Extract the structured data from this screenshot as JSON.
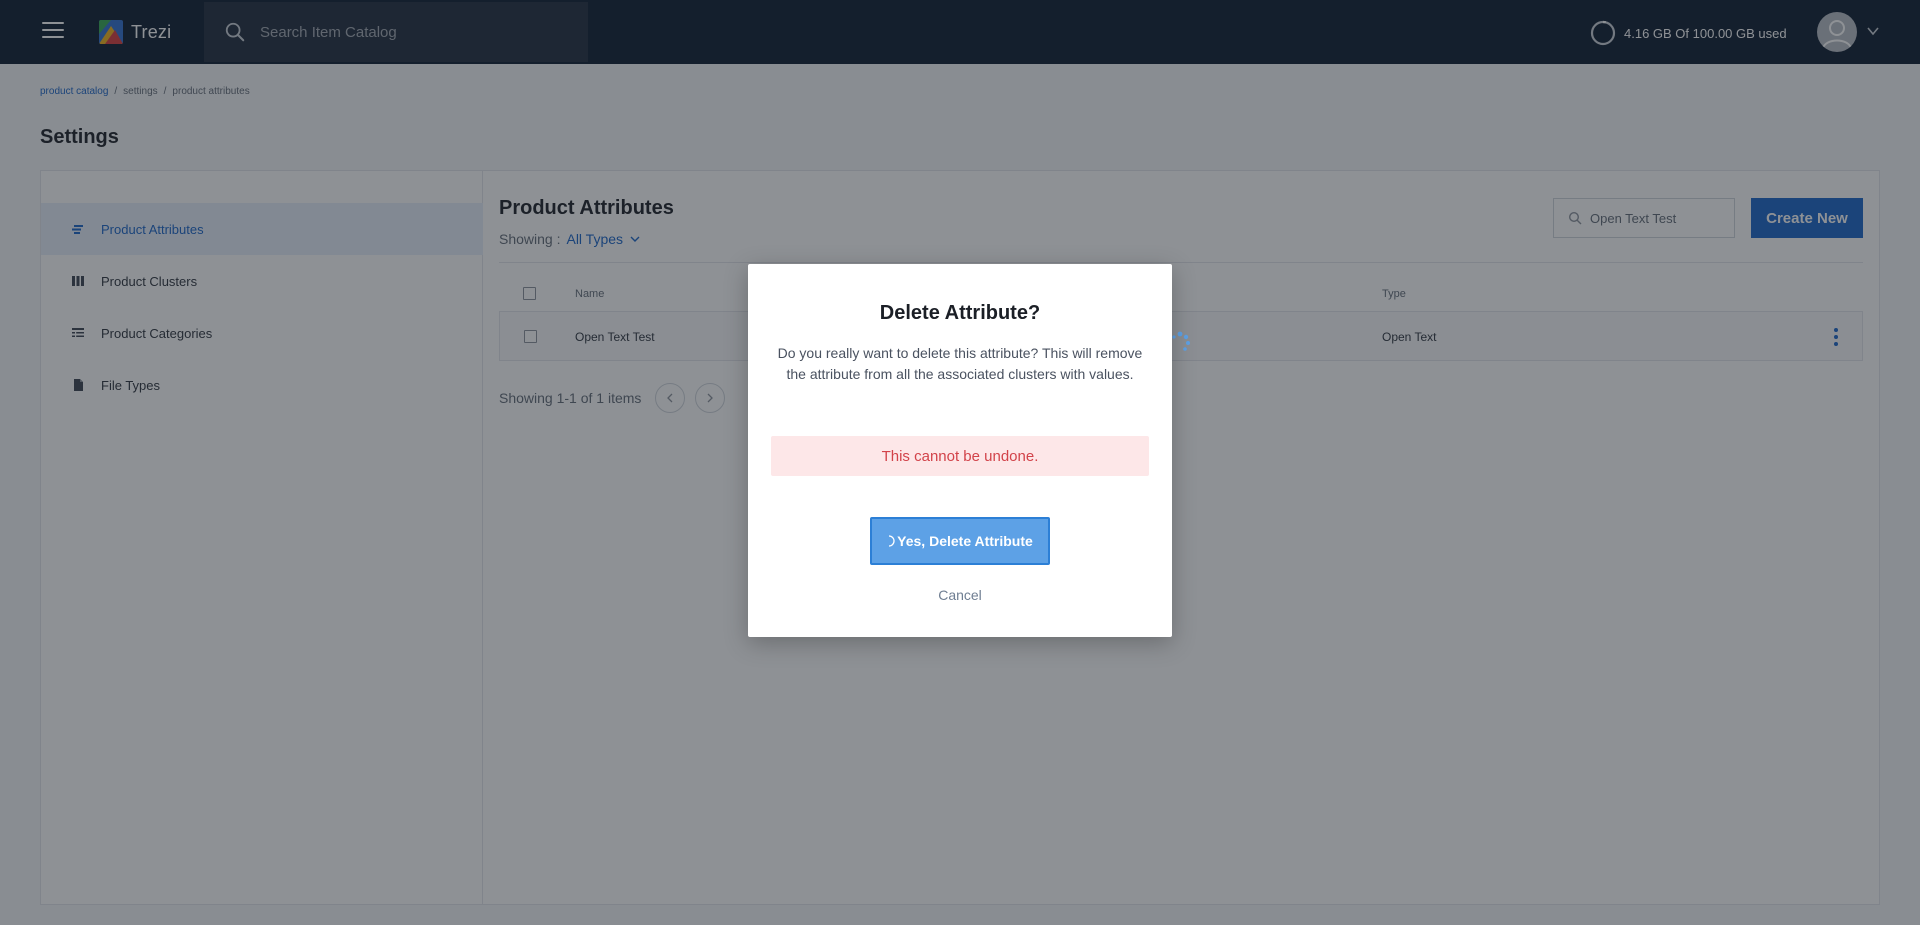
{
  "topbar": {
    "app_name": "Trezi",
    "search_placeholder": "Search Item Catalog",
    "storage_text": "4.16 GB Of 100.00 GB used",
    "storage_used_fraction": 0.0416
  },
  "breadcrumb": {
    "items": [
      "product catalog",
      "settings",
      "product attributes"
    ],
    "separator": "/"
  },
  "page": {
    "title": "Settings"
  },
  "sidebar": {
    "items": [
      {
        "label": "Product Attributes",
        "icon": "attributes-icon",
        "active": true
      },
      {
        "label": "Product Clusters",
        "icon": "clusters-icon",
        "active": false
      },
      {
        "label": "Product Categories",
        "icon": "categories-icon",
        "active": false
      },
      {
        "label": "File Types",
        "icon": "file-icon",
        "active": false
      }
    ]
  },
  "content": {
    "title": "Product Attributes",
    "showing_label": "Showing :",
    "showing_value": "All Types",
    "search_value": "Open Text Test",
    "create_label": "Create New",
    "columns": {
      "name": "Name",
      "type": "Type"
    },
    "rows": [
      {
        "name": "Open Text Test",
        "type": "Open Text"
      }
    ],
    "pagination_text": "Showing 1-1 of 1 items"
  },
  "modal": {
    "title": "Delete Attribute?",
    "body": "Do you really want to delete this attribute? This will remove the attribute from all the associated clusters with values.",
    "warning": "This cannot be undone.",
    "confirm_label": "Yes, Delete Attribute",
    "cancel_label": "Cancel"
  },
  "colors": {
    "topbar_bg": "#0b1a2e",
    "accent": "#1964c8",
    "warning_bg": "#fde7e8",
    "warning_text": "#d2434a",
    "confirm_bg": "#5da1e6"
  }
}
